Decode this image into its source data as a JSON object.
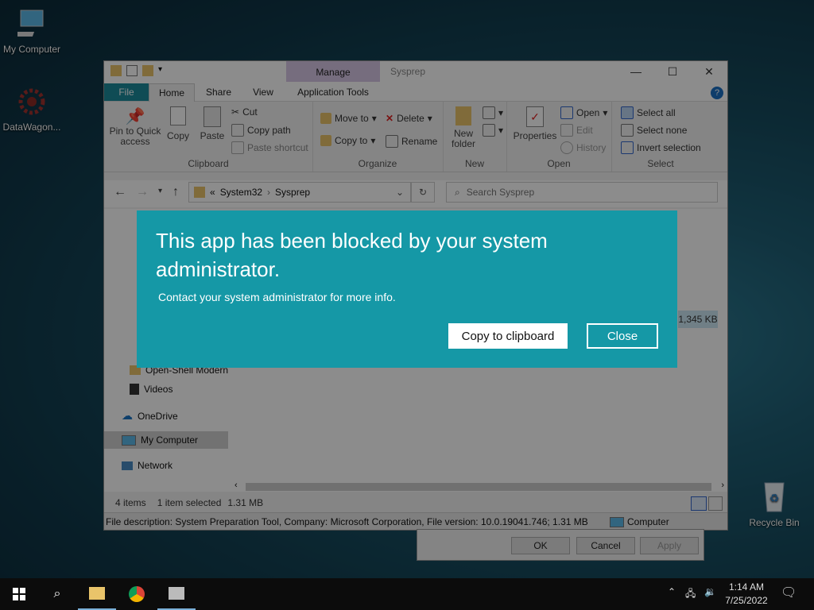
{
  "desktop": {
    "icons": [
      {
        "label": "My Computer",
        "icon": "computer-icon"
      },
      {
        "label": "DataWagon...",
        "icon": "datawagon-icon"
      },
      {
        "label": "Recycle Bin",
        "icon": "recycle-bin-icon"
      }
    ]
  },
  "explorer": {
    "title": "Sysprep",
    "manage_tab": "Manage",
    "context_tab": "Application Tools",
    "tabs": [
      "File",
      "Home",
      "Share",
      "View"
    ],
    "ribbon": {
      "clipboard": {
        "label": "Clipboard",
        "pin": "Pin to Quick access",
        "copy": "Copy",
        "paste": "Paste",
        "cut": "Cut",
        "copy_path": "Copy path",
        "paste_shortcut": "Paste shortcut"
      },
      "organize": {
        "label": "Organize",
        "move_to": "Move to",
        "copy_to": "Copy to",
        "delete": "Delete",
        "rename": "Rename"
      },
      "new": {
        "label": "New",
        "new_folder": "New folder"
      },
      "open": {
        "label": "Open",
        "properties": "Properties",
        "open": "Open",
        "edit": "Edit",
        "history": "History"
      },
      "select": {
        "label": "Select",
        "select_all": "Select all",
        "select_none": "Select none",
        "invert": "Invert selection"
      }
    },
    "breadcrumb": {
      "prefix": "«",
      "items": [
        "System32",
        "Sysprep"
      ]
    },
    "search_placeholder": "Search Sysprep",
    "sidebar": [
      "Open-Shell Modern",
      "Videos",
      "OneDrive",
      "My Computer",
      "Network"
    ],
    "file_size_hint": "1,345 KB",
    "status": {
      "items": "4 items",
      "selected": "1 item selected",
      "size": "1.31 MB"
    },
    "details_bar": {
      "description": "File description: System Preparation Tool, Company: Microsoft Corporation, File version: 10.0.19041.746; 1.31 MB",
      "location": "Computer"
    }
  },
  "properties_dialog": {
    "ok": "OK",
    "cancel": "Cancel",
    "apply": "Apply"
  },
  "block_dialog": {
    "title": "This app has been blocked by your system administrator.",
    "message": "Contact your system administrator for more info.",
    "copy_button": "Copy to clipboard",
    "close_button": "Close",
    "color": "#1598a6"
  },
  "taskbar": {
    "time": "1:14 AM",
    "date": "7/25/2022"
  }
}
